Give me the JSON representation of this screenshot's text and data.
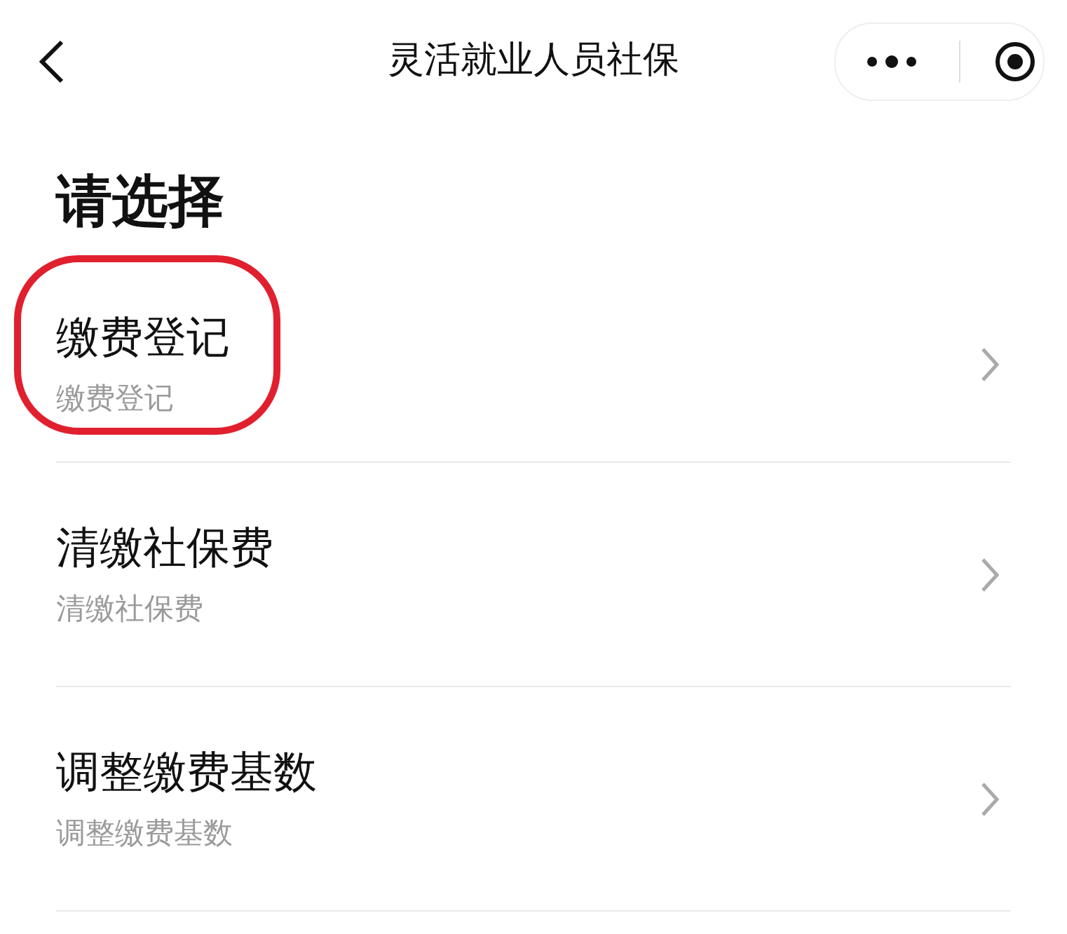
{
  "nav_bar": {
    "title": "灵活就业人员社保"
  },
  "heading": "请选择",
  "options": [
    {
      "title": "缴费登记",
      "subtitle": "缴费登记",
      "circled": true
    },
    {
      "title": "清缴社保费",
      "subtitle": "清缴社保费",
      "circled": false
    },
    {
      "title": "调整缴费基数",
      "subtitle": "调整缴费基数",
      "circled": false
    }
  ]
}
